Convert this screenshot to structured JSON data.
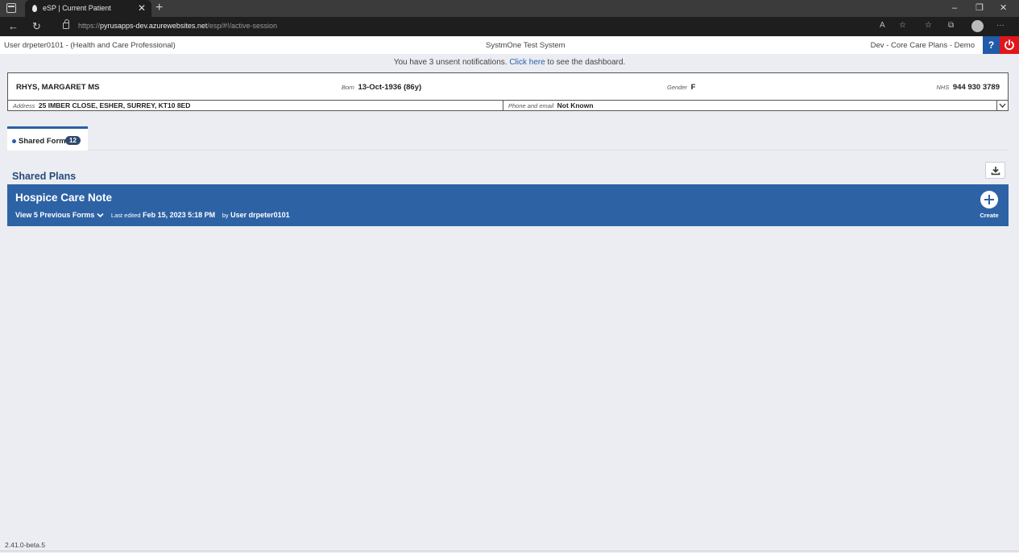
{
  "browser": {
    "tab_title": "eSP | Current Patient",
    "new_tab": "+",
    "close_tab": "✕",
    "url_prefix": "https://",
    "url_host": "pyrusapps-dev.azurewebsites.net",
    "url_path": "/esp/#!/active-session",
    "window": {
      "minimize": "–",
      "restore": "❐",
      "close": "✕"
    },
    "nav": {
      "back": "←",
      "reload": "↻"
    },
    "tools": {
      "read_aloud": "A",
      "favorite": "☆",
      "favorites": "☆",
      "collections": "⧉",
      "more": "···"
    }
  },
  "header": {
    "user": "User drpeter0101 - (Health and Care Professional)",
    "system": "SystmOne Test System",
    "environment": "Dev - Core Care Plans - Demo",
    "help": "?"
  },
  "notification": {
    "before": "You have 3 unsent notifications. ",
    "link": "Click here",
    "after": " to see the dashboard."
  },
  "patient": {
    "name": "RHYS, MARGARET MS",
    "born_label": "Born",
    "born_value": "13-Oct-1936 (86y)",
    "gender_label": "Gender",
    "gender_value": "F",
    "nhs_label": "NHS",
    "nhs_value": "944 930 3789",
    "address_label": "Address",
    "address_value": "25 IMBER CLOSE, ESHER, SURREY, KT10 8ED",
    "phone_label": "Phone and email",
    "phone_value": "Not Known"
  },
  "tabs": [
    {
      "label": "Shared Forms",
      "count": "12"
    }
  ],
  "section": {
    "title": "Shared Plans"
  },
  "form_card": {
    "title": "Hospice Care Note",
    "previous": "View 5 Previous Forms",
    "last_edited_label": "Last edited",
    "last_edited_value": "Feb 15, 2023 5:18 PM",
    "by_label": "by",
    "by_value": "User drpeter0101",
    "create_label": "Create"
  },
  "footer": {
    "version": "2.41.0-beta.5"
  },
  "colors": {
    "primary": "#2d62a5",
    "heading": "#264b78",
    "danger": "#e1161c",
    "background": "#ebedf2"
  },
  "icons": {
    "help": "question-icon",
    "power": "power-icon",
    "download": "download-icon",
    "create": "plus-icon",
    "expand": "chevron-down-icon"
  }
}
